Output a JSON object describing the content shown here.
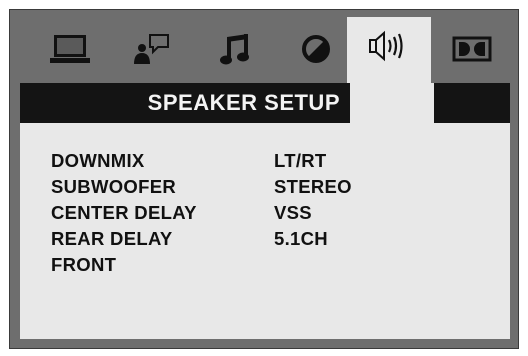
{
  "tabs": [
    {
      "icon": "monitor-icon",
      "active": false
    },
    {
      "icon": "person-speech-icon",
      "active": false
    },
    {
      "icon": "music-note-icon",
      "active": false
    },
    {
      "icon": "circle-slash-icon",
      "active": false
    },
    {
      "icon": "speaker-icon",
      "active": true
    },
    {
      "icon": "dolby-icon",
      "active": false
    }
  ],
  "title": "SPEAKER SETUP",
  "settings": [
    {
      "label": "DOWNMIX",
      "value": "LT/RT"
    },
    {
      "label": "SUBWOOFER",
      "value": "STEREO"
    },
    {
      "label": "CENTER DELAY",
      "value": "VSS"
    },
    {
      "label": "REAR DELAY",
      "value": "5.1CH"
    },
    {
      "label": "FRONT",
      "value": ""
    }
  ],
  "colors": {
    "frame": "#6e6e6e",
    "panel": "#e8e8e8",
    "title_bar": "#141414",
    "text": "#111111"
  }
}
